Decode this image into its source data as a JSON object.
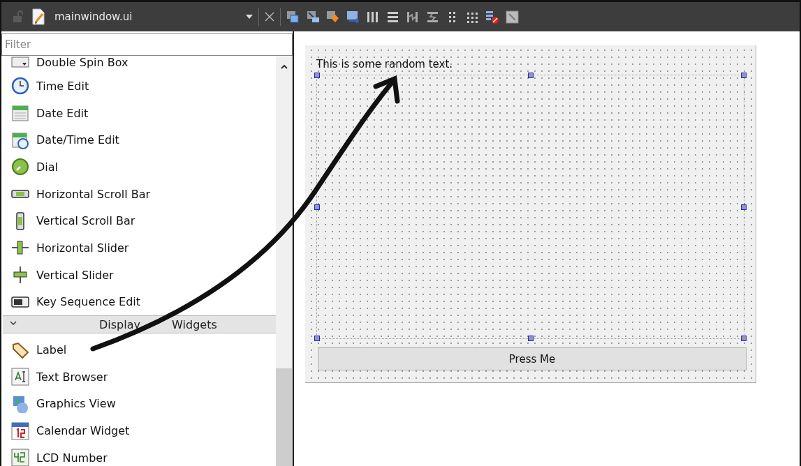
{
  "editor_bar": {
    "filename": "mainwindow.ui",
    "locked": false
  },
  "widget_box": {
    "filter": {
      "placeholder": "Filter"
    },
    "items": [
      {
        "kind": "item",
        "label": "Double Spin Box"
      },
      {
        "kind": "item",
        "label": "Time Edit"
      },
      {
        "kind": "item",
        "label": "Date Edit"
      },
      {
        "kind": "item",
        "label": "Date/Time Edit"
      },
      {
        "kind": "item",
        "label": "Dial"
      },
      {
        "kind": "item",
        "label": "Horizontal Scroll Bar"
      },
      {
        "kind": "item",
        "label": "Vertical Scroll Bar"
      },
      {
        "kind": "item",
        "label": "Horizontal Slider"
      },
      {
        "kind": "item",
        "label": "Vertical Slider"
      },
      {
        "kind": "item",
        "label": "Key Sequence Edit"
      },
      {
        "kind": "category",
        "label": "Display Widgets",
        "expanded": true
      },
      {
        "kind": "item",
        "label": "Label"
      },
      {
        "kind": "item",
        "label": "Text Browser"
      },
      {
        "kind": "item",
        "label": "Graphics View"
      },
      {
        "kind": "item",
        "label": "Calendar Widget"
      },
      {
        "kind": "item",
        "label": "LCD Number"
      }
    ]
  },
  "form": {
    "label_text": "This is some random text.",
    "button": "Press Me"
  }
}
